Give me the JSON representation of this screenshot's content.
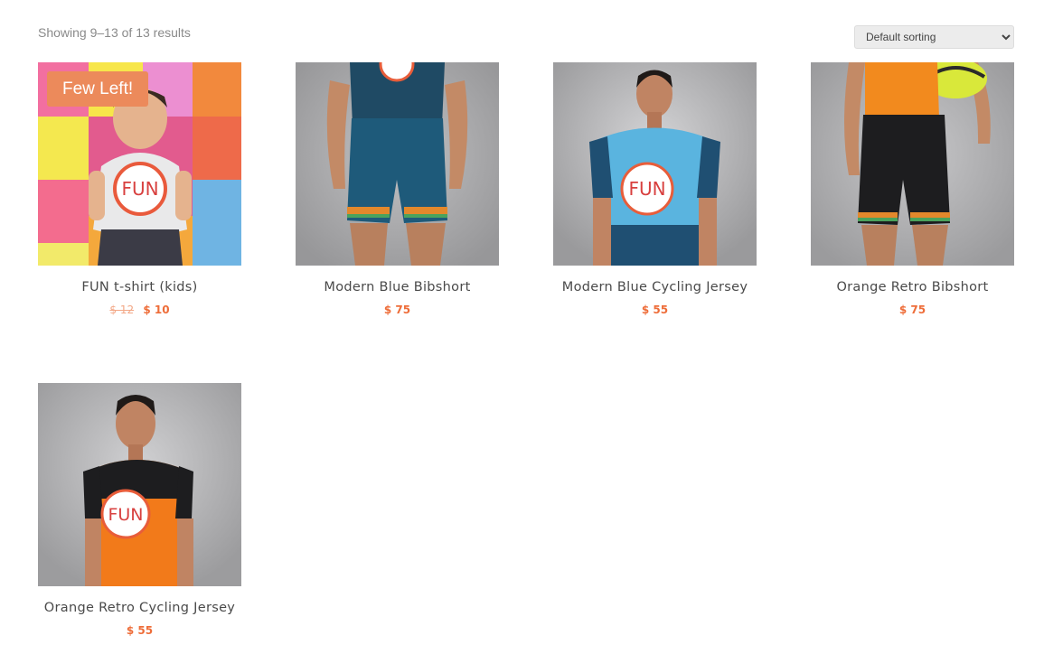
{
  "toolbar": {
    "result_count": "Showing 9–13 of 13 results",
    "sort_selected": "Default sorting"
  },
  "products": [
    {
      "title": "FUN t-shirt (kids)",
      "old_price": "$ 12",
      "price": "$ 10",
      "badge": "Few Left!",
      "image": "child-fun-tshirt-photo"
    },
    {
      "title": "Modern Blue Bibshort",
      "price": "$ 75",
      "image": "blue-bibshort-photo"
    },
    {
      "title": "Modern Blue Cycling Jersey",
      "price": "$ 55",
      "image": "blue-jersey-photo"
    },
    {
      "title": "Orange Retro Bibshort",
      "price": "$ 75",
      "image": "orange-bibshort-photo"
    },
    {
      "title": "Orange Retro Cycling Jersey",
      "price": "$ 55",
      "image": "orange-jersey-photo"
    }
  ],
  "colors": {
    "price": "#ee6d39",
    "badge": "#ec8a5b",
    "muted_text": "#8a8a8a"
  }
}
